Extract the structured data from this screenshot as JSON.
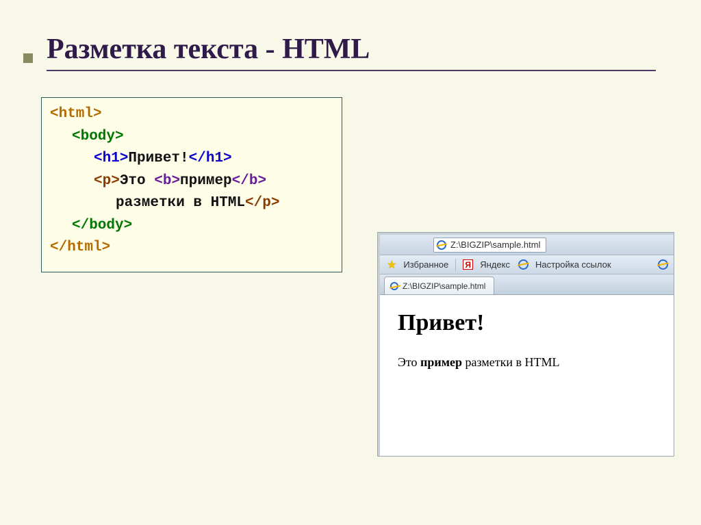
{
  "title": "Разметка текста - HTML",
  "code": {
    "html_open": "<html>",
    "body_open": "<body>",
    "h1_open": "<h1>",
    "h1_text": "Привет!",
    "h1_close": "</h1>",
    "p_open": "<p>",
    "p_t1": "Это ",
    "b_open": "<b>",
    "b_text": "пример",
    "b_close": "</b>",
    "line2": "разметки в HTML",
    "p_close": "</p>",
    "body_close": "</body>",
    "html_close": "</html>"
  },
  "browser": {
    "address": "Z:\\BIGZIP\\sample.html",
    "fav_label": "Избранное",
    "yandex": "Яндекс",
    "settings": "Настройка ссылок",
    "tab_title": "Z:\\BIGZIP\\sample.html",
    "y_glyph": "Я"
  },
  "rendered": {
    "heading": "Привет!",
    "p_before": "Это ",
    "p_bold": "пример",
    "p_after": " разметки в HTML"
  }
}
